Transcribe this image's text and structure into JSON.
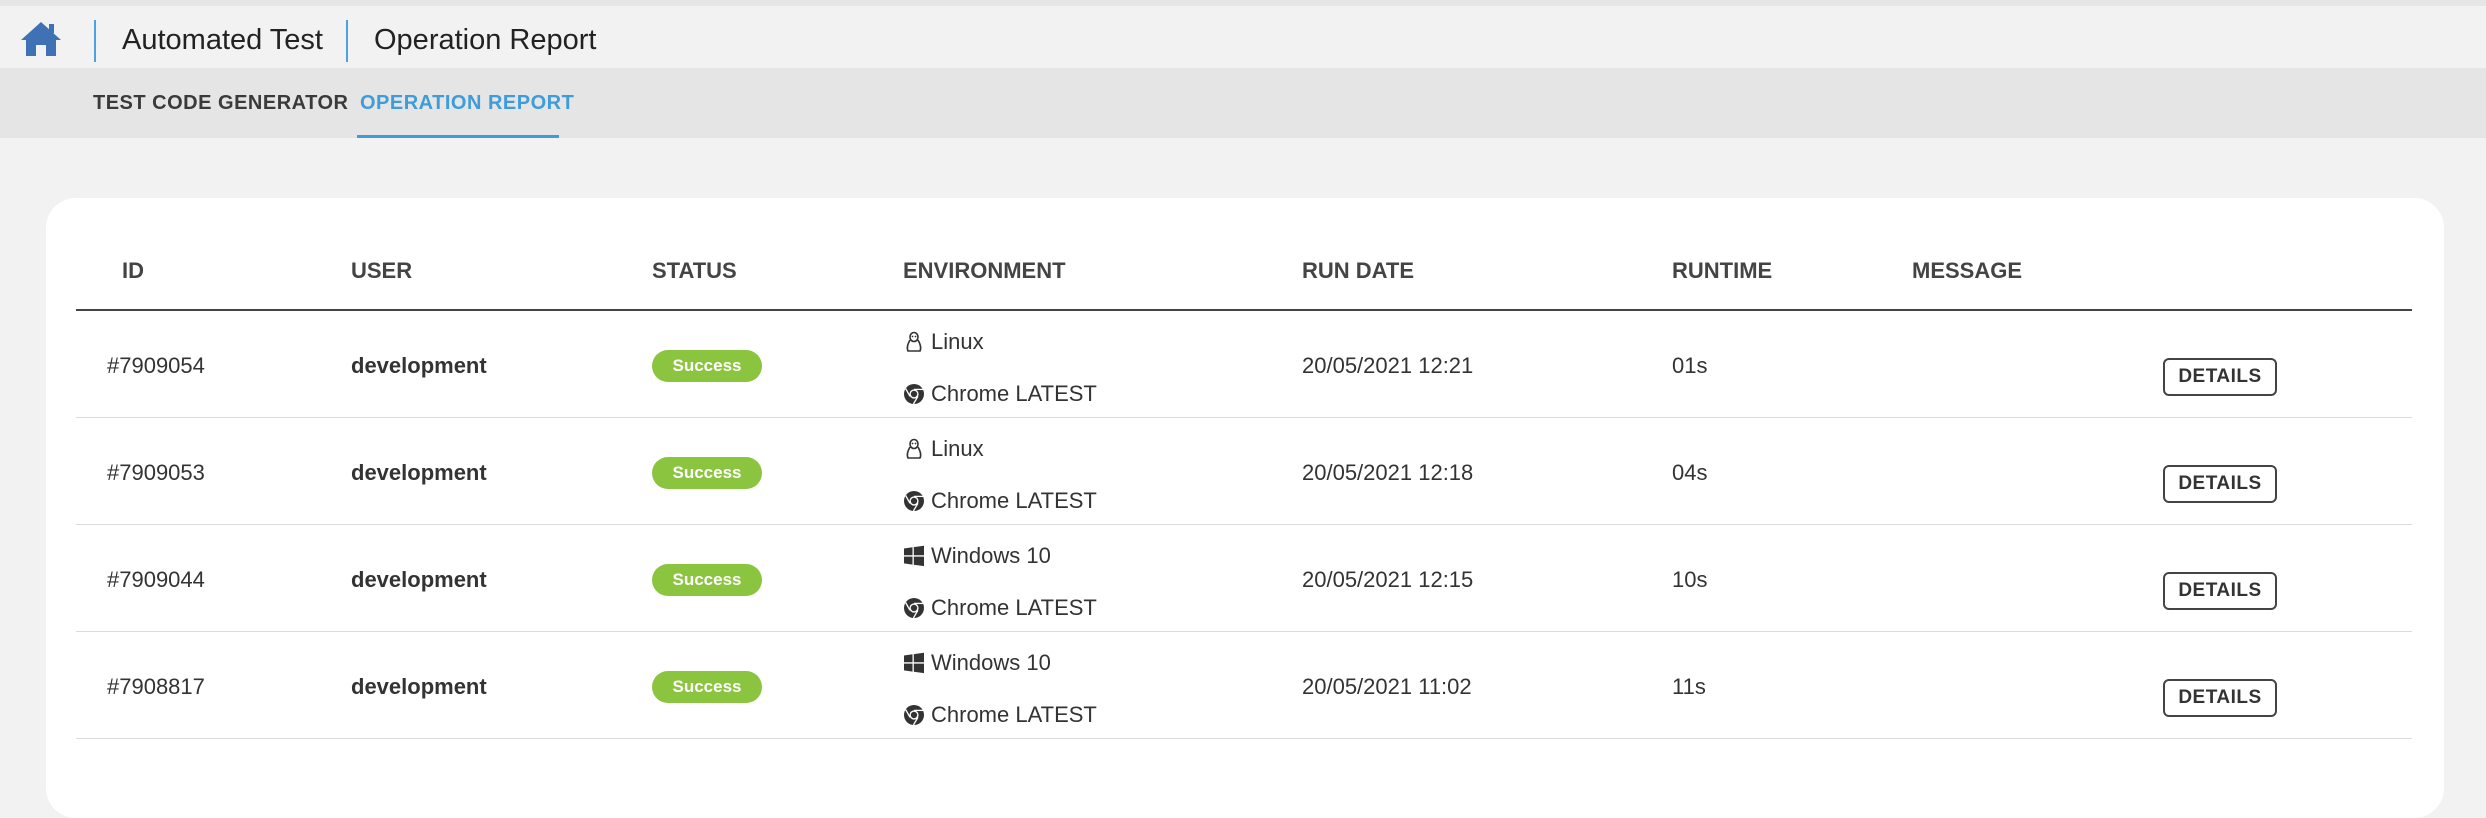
{
  "header": {
    "title": "Automated Test",
    "subtitle": "Operation Report"
  },
  "tabs": [
    {
      "label": "TEST CODE GENERATOR",
      "active": false
    },
    {
      "label": "OPERATION REPORT",
      "active": true
    }
  ],
  "table": {
    "columns": [
      "ID",
      "USER",
      "STATUS",
      "ENVIRONMENT",
      "RUN DATE",
      "RUNTIME",
      "MESSAGE"
    ],
    "rows": [
      {
        "id": "#7909054",
        "user": "development",
        "status": "Success",
        "os": "Linux",
        "os_icon": "linux-icon",
        "browser": "Chrome LATEST",
        "run_date": "20/05/2021 12:21",
        "runtime": "01s",
        "message": "",
        "action": "DETAILS"
      },
      {
        "id": "#7909053",
        "user": "development",
        "status": "Success",
        "os": "Linux",
        "os_icon": "linux-icon",
        "browser": "Chrome LATEST",
        "run_date": "20/05/2021 12:18",
        "runtime": "04s",
        "message": "",
        "action": "DETAILS"
      },
      {
        "id": "#7909044",
        "user": "development",
        "status": "Success",
        "os": "Windows 10",
        "os_icon": "windows-icon",
        "browser": "Chrome LATEST",
        "run_date": "20/05/2021 12:15",
        "runtime": "10s",
        "message": "",
        "action": "DETAILS"
      },
      {
        "id": "#7908817",
        "user": "development",
        "status": "Success",
        "os": "Windows 10",
        "os_icon": "windows-icon",
        "browser": "Chrome LATEST",
        "run_date": "20/05/2021 11:02",
        "runtime": "11s",
        "message": "",
        "action": "DETAILS"
      }
    ]
  },
  "colors": {
    "accent": "#3d9cd9",
    "success": "#8bc53f",
    "home_icon": "#3f72b5"
  }
}
